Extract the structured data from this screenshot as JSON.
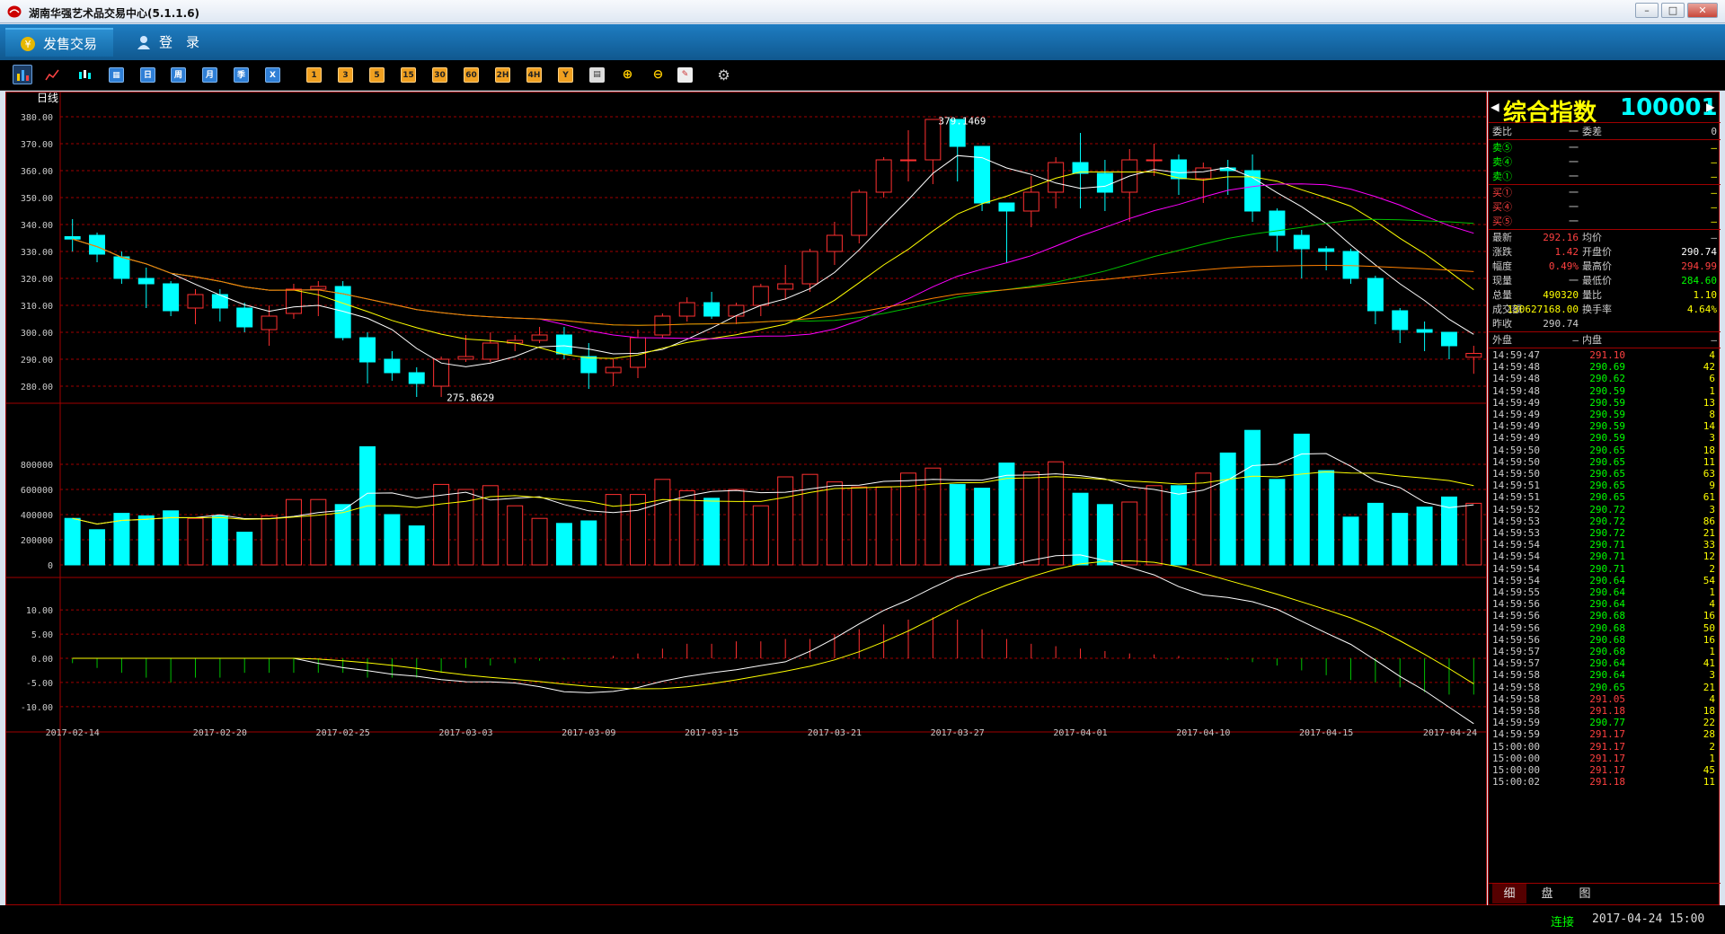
{
  "window": {
    "title": "湖南华强艺术品交易中心(5.1.1.6)"
  },
  "menu": {
    "sale": "发售交易",
    "login": "登　录"
  },
  "toolbar": {
    "icons": [
      "bar-chart-icon",
      "line-chart-icon",
      "candle-icon",
      "calendar-icon"
    ],
    "periods": [
      "日",
      "周",
      "月",
      "季",
      "X"
    ],
    "minutes": [
      "1",
      "3",
      "5",
      "15",
      "30",
      "60",
      "2H",
      "4H",
      "Y"
    ],
    "tools": [
      "grid-icon",
      "zoom-in-icon",
      "zoom-out-icon",
      "draw-icon",
      "gear-icon"
    ]
  },
  "chart": {
    "period_label": "日线",
    "high_label": "379.1469",
    "low_label": "275.8629",
    "price_ticks": [
      "380.00",
      "370.00",
      "360.00",
      "350.00",
      "340.00",
      "330.00",
      "320.00",
      "310.00",
      "300.00",
      "290.00",
      "280.00"
    ],
    "volume_ticks": [
      "800000",
      "600000",
      "400000",
      "200000",
      "0"
    ],
    "macd_ticks": [
      "10.00",
      "5.00",
      "0.00",
      "-5.00",
      "-10.00"
    ],
    "dates": [
      "2017-02-14",
      "2017-02-20",
      "2017-02-25",
      "2017-03-03",
      "2017-03-09",
      "2017-03-15",
      "2017-03-21",
      "2017-03-27",
      "2017-04-01",
      "2017-04-10",
      "2017-04-15",
      "2017-04-24"
    ],
    "colors": {
      "up": "#ff3030",
      "down": "#00ffff",
      "ma5": "#ffffff",
      "ma10": "#ffff00",
      "ma20": "#ff00ff",
      "ma30": "#00c000",
      "ma60": "#ff8000",
      "grid": "#a00000"
    }
  },
  "chart_data": {
    "type": "candlestick",
    "candles": [
      {
        "o": 335.5,
        "c": 334.6,
        "h": 342,
        "l": 330
      },
      {
        "o": 336,
        "c": 329,
        "h": 337,
        "l": 326
      },
      {
        "o": 328,
        "c": 320,
        "h": 330,
        "l": 318
      },
      {
        "o": 320,
        "c": 318,
        "h": 324,
        "l": 309
      },
      {
        "o": 318,
        "c": 308,
        "h": 319,
        "l": 306
      },
      {
        "o": 309,
        "c": 314,
        "h": 316,
        "l": 303
      },
      {
        "o": 314,
        "c": 309,
        "h": 316,
        "l": 304
      },
      {
        "o": 309,
        "c": 302,
        "h": 311,
        "l": 300
      },
      {
        "o": 301,
        "c": 306,
        "h": 310,
        "l": 295
      },
      {
        "o": 307,
        "c": 316,
        "h": 318,
        "l": 305
      },
      {
        "o": 316,
        "c": 317,
        "h": 319,
        "l": 306
      },
      {
        "o": 317,
        "c": 298,
        "h": 319,
        "l": 297
      },
      {
        "o": 298,
        "c": 289,
        "h": 300,
        "l": 281
      },
      {
        "o": 290,
        "c": 285,
        "h": 293,
        "l": 282
      },
      {
        "o": 285,
        "c": 281,
        "h": 287,
        "l": 276
      },
      {
        "o": 280,
        "c": 290,
        "h": 291,
        "l": 276
      },
      {
        "o": 290,
        "c": 291,
        "h": 299,
        "l": 289
      },
      {
        "o": 290,
        "c": 296,
        "h": 300,
        "l": 289
      },
      {
        "o": 296,
        "c": 297,
        "h": 299,
        "l": 293
      },
      {
        "o": 297,
        "c": 299,
        "h": 302,
        "l": 296
      },
      {
        "o": 299,
        "c": 292,
        "h": 302,
        "l": 290
      },
      {
        "o": 291,
        "c": 285,
        "h": 296,
        "l": 279
      },
      {
        "o": 285,
        "c": 287,
        "h": 290,
        "l": 280
      },
      {
        "o": 287,
        "c": 298,
        "h": 301,
        "l": 283
      },
      {
        "o": 299,
        "c": 306,
        "h": 307,
        "l": 298
      },
      {
        "o": 306,
        "c": 311,
        "h": 313,
        "l": 304
      },
      {
        "o": 311,
        "c": 306,
        "h": 315,
        "l": 305
      },
      {
        "o": 306,
        "c": 310,
        "h": 311,
        "l": 303
      },
      {
        "o": 310,
        "c": 317,
        "h": 318,
        "l": 306
      },
      {
        "o": 316,
        "c": 318,
        "h": 325,
        "l": 312
      },
      {
        "o": 318,
        "c": 330,
        "h": 331,
        "l": 315
      },
      {
        "o": 330,
        "c": 336,
        "h": 341,
        "l": 325
      },
      {
        "o": 336,
        "c": 352,
        "h": 353,
        "l": 333
      },
      {
        "o": 352,
        "c": 364,
        "h": 365,
        "l": 350
      },
      {
        "o": 364,
        "c": 364,
        "h": 375,
        "l": 356
      },
      {
        "o": 364,
        "c": 379,
        "h": 379.15,
        "l": 355
      },
      {
        "o": 379,
        "c": 369,
        "h": 379,
        "l": 356
      },
      {
        "o": 369,
        "c": 348,
        "h": 369,
        "l": 345
      },
      {
        "o": 348,
        "c": 345,
        "h": 348,
        "l": 326
      },
      {
        "o": 345,
        "c": 352,
        "h": 358,
        "l": 339
      },
      {
        "o": 352,
        "c": 363,
        "h": 365,
        "l": 346
      },
      {
        "o": 363,
        "c": 359,
        "h": 374,
        "l": 346
      },
      {
        "o": 359,
        "c": 352,
        "h": 364,
        "l": 345
      },
      {
        "o": 352,
        "c": 364,
        "h": 368,
        "l": 341
      },
      {
        "o": 364,
        "c": 364,
        "h": 370,
        "l": 358
      },
      {
        "o": 364,
        "c": 357,
        "h": 366,
        "l": 351
      },
      {
        "o": 357,
        "c": 361,
        "h": 363,
        "l": 348
      },
      {
        "o": 361,
        "c": 360,
        "h": 364,
        "l": 351
      },
      {
        "o": 360,
        "c": 345,
        "h": 366,
        "l": 341
      },
      {
        "o": 345,
        "c": 336,
        "h": 346,
        "l": 330
      },
      {
        "o": 336,
        "c": 331,
        "h": 338,
        "l": 320
      },
      {
        "o": 331,
        "c": 330,
        "h": 332,
        "l": 323
      },
      {
        "o": 330,
        "c": 320,
        "h": 331,
        "l": 318
      },
      {
        "o": 320,
        "c": 308,
        "h": 321,
        "l": 303
      },
      {
        "o": 308,
        "c": 301,
        "h": 309,
        "l": 296
      },
      {
        "o": 301,
        "c": 300,
        "h": 304,
        "l": 293
      },
      {
        "o": 300,
        "c": 295,
        "h": 299,
        "l": 290
      },
      {
        "o": 290.74,
        "c": 292.16,
        "h": 294.99,
        "l": 284.6
      }
    ],
    "volume": [
      370000,
      280000,
      410000,
      390000,
      430000,
      370000,
      390000,
      260000,
      390000,
      520000,
      520000,
      480000,
      940000,
      400000,
      310000,
      640000,
      600000,
      630000,
      470000,
      370000,
      330000,
      350000,
      560000,
      560000,
      680000,
      590000,
      530000,
      600000,
      470000,
      700000,
      720000,
      660000,
      620000,
      620000,
      730000,
      770000,
      640000,
      610000,
      810000,
      740000,
      820000,
      570000,
      480000,
      500000,
      630000,
      630000,
      730000,
      890000,
      1070000,
      680000,
      1040000,
      750000,
      380000,
      490000,
      410000,
      460000,
      540000,
      490000
    ],
    "macd_hist": [
      -1,
      -2,
      -3,
      -4,
      -5,
      -4,
      -4,
      -3,
      -3,
      -3,
      -3,
      -3,
      -4,
      -4,
      -4,
      -3,
      -2,
      -1.5,
      -1,
      -0.5,
      -0.3,
      -0.2,
      0.5,
      1,
      2,
      3,
      3,
      3.5,
      3.5,
      4,
      4,
      5,
      6,
      7,
      8,
      8.5,
      8,
      6,
      4,
      3,
      2.5,
      2,
      1.5,
      1,
      0.8,
      0.5,
      0,
      -0.3,
      -0.8,
      -1.5,
      -2.5,
      -3.5,
      -4.5,
      -5,
      -6,
      -7,
      -7.5,
      -7.5
    ],
    "ylim_price": [
      275,
      385
    ],
    "ylim_volume": [
      0,
      1100000
    ],
    "ylim_macd": [
      -13,
      13
    ]
  },
  "panel": {
    "title": "综合指数",
    "code": "100001",
    "weibi_label": "委比",
    "weibi_val": "一",
    "weicha_label": "委差",
    "weicha_val": "0",
    "sell": [
      {
        "l": "卖⑤",
        "v": "一",
        "q": "—"
      },
      {
        "l": "卖④",
        "v": "一",
        "q": "—"
      },
      {
        "l": "卖①",
        "v": "一",
        "q": "—"
      }
    ],
    "buy": [
      {
        "l": "买①",
        "v": "一",
        "q": "—"
      },
      {
        "l": "买④",
        "v": "一",
        "q": "—"
      },
      {
        "l": "买⑤",
        "v": "一",
        "q": "—"
      }
    ],
    "quote": [
      {
        "l1": "最新",
        "v1": "292.16",
        "l2": "均价",
        "v2": "—"
      },
      {
        "l1": "涨跌",
        "v1": "1.42",
        "l2": "开盘价",
        "v2": "290.74"
      },
      {
        "l1": "幅度",
        "v1": "0.49%",
        "l2": "最高价",
        "v2": "294.99"
      },
      {
        "l1": "现量",
        "v1": "一",
        "l2": "最低价",
        "v2": "284.60"
      },
      {
        "l1": "总量",
        "v1": "490320",
        "l2": "量比",
        "v2": "1.10"
      },
      {
        "l1": "成交额",
        "v1": "130627168.00",
        "l2": "换手率",
        "v2": "4.64%"
      },
      {
        "l1": "昨收",
        "v1": "290.74",
        "l2": "",
        "v2": ""
      }
    ],
    "outer_label": "外盘",
    "outer_val": "—",
    "inner_label": "内盘",
    "inner_val": "—",
    "ticks": [
      {
        "t": "14:59:47",
        "p": "291.10",
        "q": "4"
      },
      {
        "t": "14:59:48",
        "p": "290.69",
        "q": "42"
      },
      {
        "t": "14:59:48",
        "p": "290.62",
        "q": "6"
      },
      {
        "t": "14:59:48",
        "p": "290.59",
        "q": "1"
      },
      {
        "t": "14:59:49",
        "p": "290.59",
        "q": "13"
      },
      {
        "t": "14:59:49",
        "p": "290.59",
        "q": "8"
      },
      {
        "t": "14:59:49",
        "p": "290.59",
        "q": "14"
      },
      {
        "t": "14:59:49",
        "p": "290.59",
        "q": "3"
      },
      {
        "t": "14:59:50",
        "p": "290.65",
        "q": "18"
      },
      {
        "t": "14:59:50",
        "p": "290.65",
        "q": "11"
      },
      {
        "t": "14:59:50",
        "p": "290.65",
        "q": "63"
      },
      {
        "t": "14:59:51",
        "p": "290.65",
        "q": "9"
      },
      {
        "t": "14:59:51",
        "p": "290.65",
        "q": "61"
      },
      {
        "t": "14:59:52",
        "p": "290.72",
        "q": "3"
      },
      {
        "t": "14:59:53",
        "p": "290.72",
        "q": "86"
      },
      {
        "t": "14:59:53",
        "p": "290.72",
        "q": "21"
      },
      {
        "t": "14:59:54",
        "p": "290.71",
        "q": "33"
      },
      {
        "t": "14:59:54",
        "p": "290.71",
        "q": "12"
      },
      {
        "t": "14:59:54",
        "p": "290.71",
        "q": "2"
      },
      {
        "t": "14:59:54",
        "p": "290.64",
        "q": "54"
      },
      {
        "t": "14:59:55",
        "p": "290.64",
        "q": "1"
      },
      {
        "t": "14:59:56",
        "p": "290.64",
        "q": "4"
      },
      {
        "t": "14:59:56",
        "p": "290.68",
        "q": "16"
      },
      {
        "t": "14:59:56",
        "p": "290.68",
        "q": "50"
      },
      {
        "t": "14:59:56",
        "p": "290.68",
        "q": "16"
      },
      {
        "t": "14:59:57",
        "p": "290.68",
        "q": "1"
      },
      {
        "t": "14:59:57",
        "p": "290.64",
        "q": "41"
      },
      {
        "t": "14:59:58",
        "p": "290.64",
        "q": "3"
      },
      {
        "t": "14:59:58",
        "p": "290.65",
        "q": "21"
      },
      {
        "t": "14:59:58",
        "p": "291.05",
        "q": "4"
      },
      {
        "t": "14:59:58",
        "p": "291.18",
        "q": "18"
      },
      {
        "t": "14:59:59",
        "p": "290.77",
        "q": "22"
      },
      {
        "t": "14:59:59",
        "p": "291.17",
        "q": "28"
      },
      {
        "t": "15:00:00",
        "p": "291.17",
        "q": "2"
      },
      {
        "t": "15:00:00",
        "p": "291.17",
        "q": "1"
      },
      {
        "t": "15:00:00",
        "p": "291.17",
        "q": "45"
      },
      {
        "t": "15:00:02",
        "p": "291.18",
        "q": "11"
      }
    ],
    "tabs": [
      "细",
      "盘",
      "图"
    ]
  },
  "status": {
    "connection": "连接",
    "datetime": "2017-04-24 15:00"
  }
}
